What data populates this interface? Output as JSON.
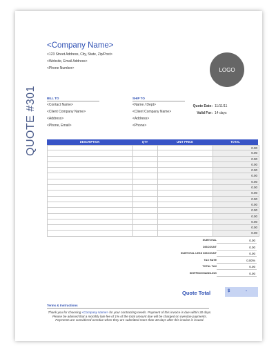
{
  "document": {
    "vertical_title": "QUOTE #301",
    "company": {
      "name": "<Company Name>",
      "address": "<123 Street Address, City, State, Zip/Post>",
      "website_email": "<Website, Email Address>",
      "phone": "<Phone Number>"
    },
    "logo_text": "LOGO",
    "bill_to": {
      "label": "BILL TO",
      "lines": [
        "<Contact Name>",
        "<Client Company Name>",
        "<Address>",
        "<Phone, Email>"
      ]
    },
    "ship_to": {
      "label": "SHIP TO",
      "lines": [
        "<Name / Dept>",
        "<Client Company Name>",
        "<Address>",
        "<Phone>"
      ]
    },
    "meta": {
      "quote_date_label": "Quote Date:",
      "quote_date": "11/11/11",
      "valid_for_label": "Valid For:",
      "valid_for": "14 days"
    },
    "table": {
      "headers": [
        "DESCRIPTION",
        "QTY",
        "UNIT PRICE",
        "TOTAL"
      ],
      "row_totals": [
        "0.00",
        "0.00",
        "0.00",
        "0.00",
        "0.00",
        "0.00",
        "0.00",
        "0.00",
        "0.00",
        "0.00",
        "0.00",
        "0.00",
        "0.00",
        "0.00",
        "0.00",
        "0.00"
      ]
    },
    "summary": [
      {
        "label": "SUBTOTAL",
        "value": "0.00"
      },
      {
        "label": "DISCOUNT",
        "value": "0.00"
      },
      {
        "label": "SUBTOTAL LESS DISCOUNT",
        "value": "0.00"
      },
      {
        "label": "TAX RATE",
        "value": "0.00%"
      },
      {
        "label": "TOTAL TAX",
        "value": "0.00"
      },
      {
        "label": "SHIPPING/HANDLING",
        "value": "0.00"
      }
    ],
    "quote_total": {
      "label": "Quote Total",
      "currency": "$",
      "amount": "-"
    },
    "terms": {
      "label": "Terms & Instructions",
      "text_before": "Thank you for choosing ",
      "company_ref": "<Company Name>",
      "text_after": " for your contracting needs. Payment of this invoice is due within 30 days. Please be advised that a monthly late fee of 1% of the total amount due will be charged on overdue payments. Payments are considered overdue when they are submitted more than 30 days after this invoice is issued."
    },
    "colors": {
      "accent": "#2d4fb3",
      "header_bg": "#3854c6",
      "total_bg": "#c7d4f3",
      "logo_bg": "#666666"
    }
  }
}
